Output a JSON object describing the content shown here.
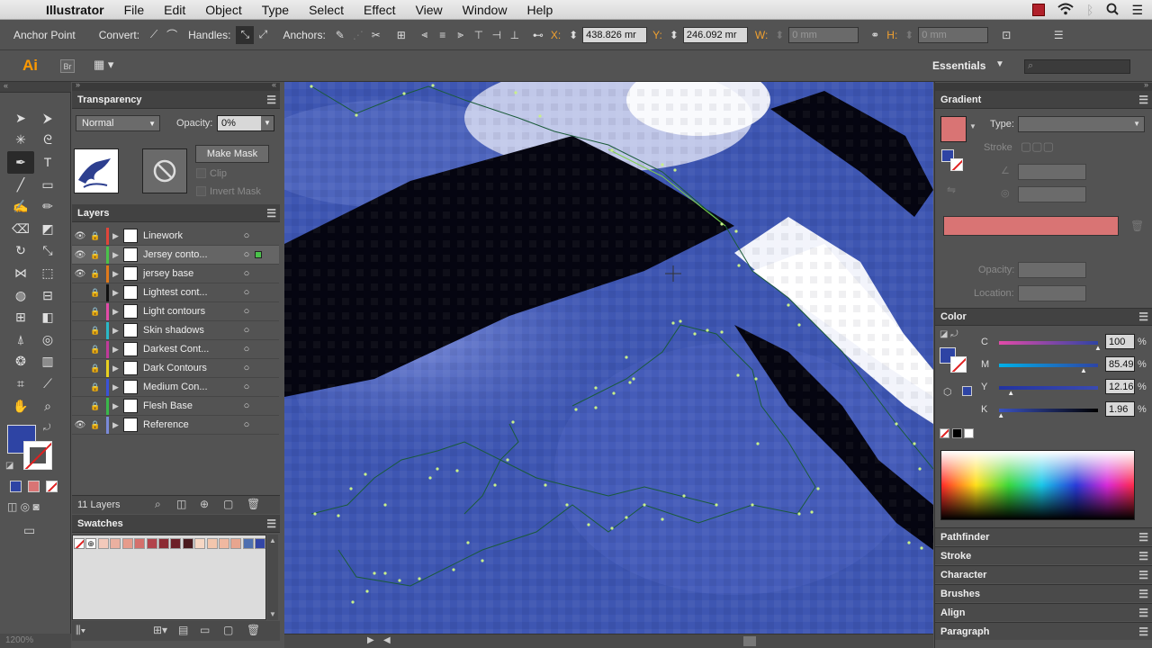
{
  "menubar": {
    "app": "Illustrator",
    "items": [
      "File",
      "Edit",
      "Object",
      "Type",
      "Select",
      "Effect",
      "View",
      "Window",
      "Help"
    ]
  },
  "control_bar": {
    "tool_name": "Anchor Point",
    "convert_label": "Convert:",
    "handles_label": "Handles:",
    "anchors_label": "Anchors:",
    "x_label": "X:",
    "x_value": "438.826 mr",
    "y_label": "Y:",
    "y_value": "246.092 mr",
    "w_label": "W:",
    "w_value": "0 mm",
    "h_label": "H:",
    "h_value": "0 mm"
  },
  "app_bar": {
    "logo": "Ai",
    "bridge": "Br",
    "workspace": "Essentials"
  },
  "transparency": {
    "title": "Transparency",
    "blend_mode": "Normal",
    "opacity_label": "Opacity:",
    "opacity_value": "0%",
    "make_mask": "Make Mask",
    "clip": "Clip",
    "invert_mask": "Invert Mask"
  },
  "layers": {
    "title": "Layers",
    "count": "11 Layers",
    "items": [
      {
        "name": "Linework",
        "color": "#e0453a",
        "visible": true
      },
      {
        "name": "Jersey conto...",
        "color": "#4ac24a",
        "visible": true
      },
      {
        "name": "jersey base",
        "color": "#e07a1a",
        "visible": true
      },
      {
        "name": "Lightest cont...",
        "color": "#111111",
        "visible": false
      },
      {
        "name": "Light contours",
        "color": "#e24aa8",
        "visible": false
      },
      {
        "name": "Skin shadows",
        "color": "#2ab8c8",
        "visible": false
      },
      {
        "name": "Darkest Cont...",
        "color": "#c03a9a",
        "visible": false
      },
      {
        "name": "Dark Contours",
        "color": "#e8d020",
        "visible": false
      },
      {
        "name": "Medium Con...",
        "color": "#3a52d8",
        "visible": false
      },
      {
        "name": "Flesh Base",
        "color": "#3ab84a",
        "visible": false
      },
      {
        "name": "Reference",
        "color": "#7a8ad8",
        "visible": true
      }
    ]
  },
  "swatches": {
    "title": "Swatches",
    "colors": [
      "#f3c9bb",
      "#eab0a0",
      "#e69b8b",
      "#d46f6b",
      "#b2444c",
      "#8c2a33",
      "#6d1f27",
      "#4a1a1e",
      "#f6d7c4",
      "#f2c6ad",
      "#f0b8a0",
      "#e8a58e",
      "#4d6fb0",
      "#3346a6"
    ]
  },
  "gradient": {
    "title": "Gradient",
    "type_label": "Type:",
    "stroke_label": "Stroke",
    "opacity_label": "Opacity:",
    "location_label": "Location:",
    "fill_color": "#d97474"
  },
  "color": {
    "title": "Color",
    "channels": [
      {
        "label": "C",
        "value": "100",
        "pos": 1.0
      },
      {
        "label": "M",
        "value": "85.49",
        "pos": 0.855
      },
      {
        "label": "Y",
        "value": "12.16",
        "pos": 0.12
      },
      {
        "label": "K",
        "value": "1.96",
        "pos": 0.02
      }
    ],
    "unit": "%",
    "fill_color": "#2e44a4"
  },
  "collapsed_panels": [
    "Pathfinder",
    "Stroke",
    "Character",
    "Brushes",
    "Align",
    "Paragraph"
  ],
  "status": {
    "zoom": "1200%"
  }
}
